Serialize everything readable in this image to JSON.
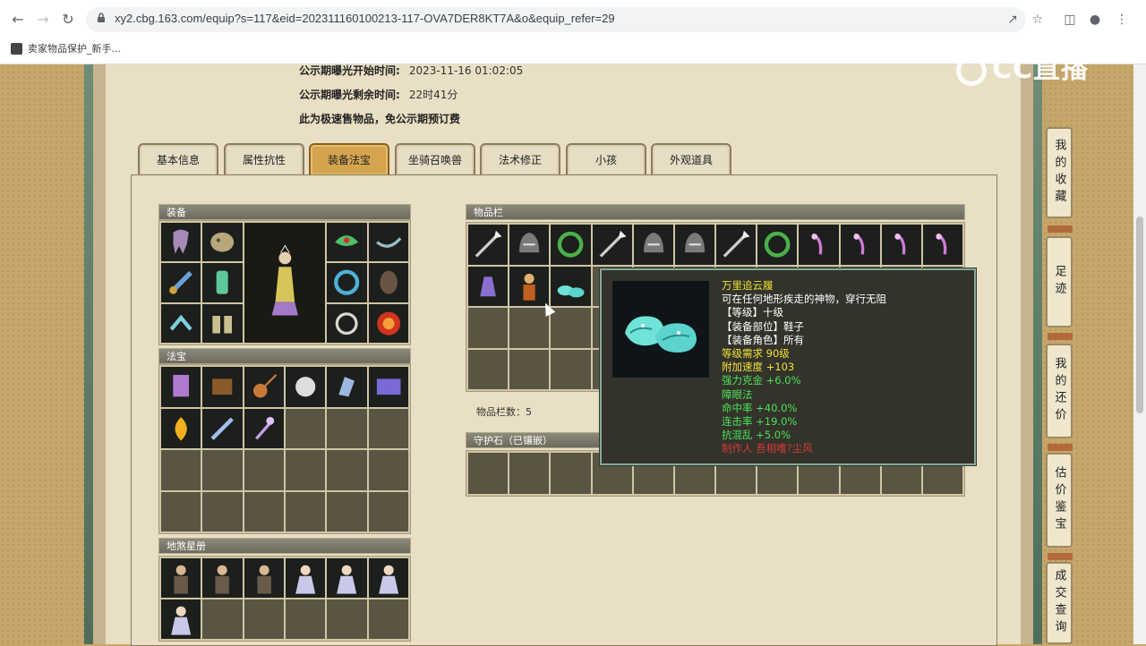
{
  "browser": {
    "url": "xy2.cbg.163.com/equip?s=117&eid=202311160100213-117-OVA7DER8KT7A&o&equip_refer=29",
    "bookmark": "卖家物品保护_新手..."
  },
  "info": {
    "start_label": "公示期曝光开始时间:",
    "start_value": "2023-11-16 01:02:05",
    "remain_label": "公示期曝光剩余时间:",
    "remain_value": "22时41分",
    "note": "此为极速售物品，免公示期预订费"
  },
  "tabs": [
    "基本信息",
    "属性抗性",
    "装备法宝",
    "坐骑召唤兽",
    "法术修正",
    "小孩",
    "外观道具"
  ],
  "active_tab": "装备法宝",
  "sections": {
    "equipment": "装备",
    "fabao": "法宝",
    "disha": "地煞星册",
    "inventory": "物品栏",
    "guard": "守护石（已镶嵌）"
  },
  "inventory_count": "物品栏数：5",
  "tooltip": {
    "name": "万里追云履",
    "desc": "可在任何地形疾走的神物，穿行无阻",
    "level": "【等级】十级",
    "slot": "【装备部位】鞋子",
    "role": "【装备角色】所有",
    "req": "等级需求 90级",
    "speed": "附加速度 +103",
    "kejin": "强力克金 +6.0%",
    "zhangyan": "障眼法",
    "hit": "命中率 +40.0%",
    "combo": "连击率 +19.0%",
    "antichaos": "抗混乱 +5.0%",
    "maker": "制作人 吾相嗜?尘风"
  },
  "sidebar": [
    "我的收藏",
    "足迹",
    "我的还价",
    "估价鉴宝",
    "成交查询"
  ],
  "logo": "CC直播",
  "colors": {
    "tooltip_name": "#f0e23a",
    "tooltip_white": "#ffffff",
    "tooltip_yellow": "#f0e23a",
    "tooltip_green": "#4ee05a",
    "tooltip_red": "#d83a3a",
    "active_tab": "#d4a44f"
  }
}
